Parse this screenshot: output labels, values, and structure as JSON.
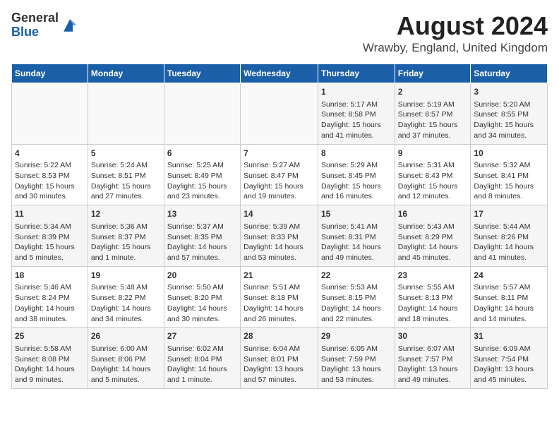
{
  "header": {
    "logo_general": "General",
    "logo_blue": "Blue",
    "title": "August 2024",
    "subtitle": "Wrawby, England, United Kingdom"
  },
  "weekdays": [
    "Sunday",
    "Monday",
    "Tuesday",
    "Wednesday",
    "Thursday",
    "Friday",
    "Saturday"
  ],
  "weeks": [
    [
      {
        "day": "",
        "text": ""
      },
      {
        "day": "",
        "text": ""
      },
      {
        "day": "",
        "text": ""
      },
      {
        "day": "",
        "text": ""
      },
      {
        "day": "1",
        "text": "Sunrise: 5:17 AM\nSunset: 8:58 PM\nDaylight: 15 hours and 41 minutes."
      },
      {
        "day": "2",
        "text": "Sunrise: 5:19 AM\nSunset: 8:57 PM\nDaylight: 15 hours and 37 minutes."
      },
      {
        "day": "3",
        "text": "Sunrise: 5:20 AM\nSunset: 8:55 PM\nDaylight: 15 hours and 34 minutes."
      }
    ],
    [
      {
        "day": "4",
        "text": "Sunrise: 5:22 AM\nSunset: 8:53 PM\nDaylight: 15 hours and 30 minutes."
      },
      {
        "day": "5",
        "text": "Sunrise: 5:24 AM\nSunset: 8:51 PM\nDaylight: 15 hours and 27 minutes."
      },
      {
        "day": "6",
        "text": "Sunrise: 5:25 AM\nSunset: 8:49 PM\nDaylight: 15 hours and 23 minutes."
      },
      {
        "day": "7",
        "text": "Sunrise: 5:27 AM\nSunset: 8:47 PM\nDaylight: 15 hours and 19 minutes."
      },
      {
        "day": "8",
        "text": "Sunrise: 5:29 AM\nSunset: 8:45 PM\nDaylight: 15 hours and 16 minutes."
      },
      {
        "day": "9",
        "text": "Sunrise: 5:31 AM\nSunset: 8:43 PM\nDaylight: 15 hours and 12 minutes."
      },
      {
        "day": "10",
        "text": "Sunrise: 5:32 AM\nSunset: 8:41 PM\nDaylight: 15 hours and 8 minutes."
      }
    ],
    [
      {
        "day": "11",
        "text": "Sunrise: 5:34 AM\nSunset: 8:39 PM\nDaylight: 15 hours and 5 minutes."
      },
      {
        "day": "12",
        "text": "Sunrise: 5:36 AM\nSunset: 8:37 PM\nDaylight: 15 hours and 1 minute."
      },
      {
        "day": "13",
        "text": "Sunrise: 5:37 AM\nSunset: 8:35 PM\nDaylight: 14 hours and 57 minutes."
      },
      {
        "day": "14",
        "text": "Sunrise: 5:39 AM\nSunset: 8:33 PM\nDaylight: 14 hours and 53 minutes."
      },
      {
        "day": "15",
        "text": "Sunrise: 5:41 AM\nSunset: 8:31 PM\nDaylight: 14 hours and 49 minutes."
      },
      {
        "day": "16",
        "text": "Sunrise: 5:43 AM\nSunset: 8:29 PM\nDaylight: 14 hours and 45 minutes."
      },
      {
        "day": "17",
        "text": "Sunrise: 5:44 AM\nSunset: 8:26 PM\nDaylight: 14 hours and 41 minutes."
      }
    ],
    [
      {
        "day": "18",
        "text": "Sunrise: 5:46 AM\nSunset: 8:24 PM\nDaylight: 14 hours and 38 minutes."
      },
      {
        "day": "19",
        "text": "Sunrise: 5:48 AM\nSunset: 8:22 PM\nDaylight: 14 hours and 34 minutes."
      },
      {
        "day": "20",
        "text": "Sunrise: 5:50 AM\nSunset: 8:20 PM\nDaylight: 14 hours and 30 minutes."
      },
      {
        "day": "21",
        "text": "Sunrise: 5:51 AM\nSunset: 8:18 PM\nDaylight: 14 hours and 26 minutes."
      },
      {
        "day": "22",
        "text": "Sunrise: 5:53 AM\nSunset: 8:15 PM\nDaylight: 14 hours and 22 minutes."
      },
      {
        "day": "23",
        "text": "Sunrise: 5:55 AM\nSunset: 8:13 PM\nDaylight: 14 hours and 18 minutes."
      },
      {
        "day": "24",
        "text": "Sunrise: 5:57 AM\nSunset: 8:11 PM\nDaylight: 14 hours and 14 minutes."
      }
    ],
    [
      {
        "day": "25",
        "text": "Sunrise: 5:58 AM\nSunset: 8:08 PM\nDaylight: 14 hours and 9 minutes."
      },
      {
        "day": "26",
        "text": "Sunrise: 6:00 AM\nSunset: 8:06 PM\nDaylight: 14 hours and 5 minutes."
      },
      {
        "day": "27",
        "text": "Sunrise: 6:02 AM\nSunset: 8:04 PM\nDaylight: 14 hours and 1 minute."
      },
      {
        "day": "28",
        "text": "Sunrise: 6:04 AM\nSunset: 8:01 PM\nDaylight: 13 hours and 57 minutes."
      },
      {
        "day": "29",
        "text": "Sunrise: 6:05 AM\nSunset: 7:59 PM\nDaylight: 13 hours and 53 minutes."
      },
      {
        "day": "30",
        "text": "Sunrise: 6:07 AM\nSunset: 7:57 PM\nDaylight: 13 hours and 49 minutes."
      },
      {
        "day": "31",
        "text": "Sunrise: 6:09 AM\nSunset: 7:54 PM\nDaylight: 13 hours and 45 minutes."
      }
    ]
  ]
}
